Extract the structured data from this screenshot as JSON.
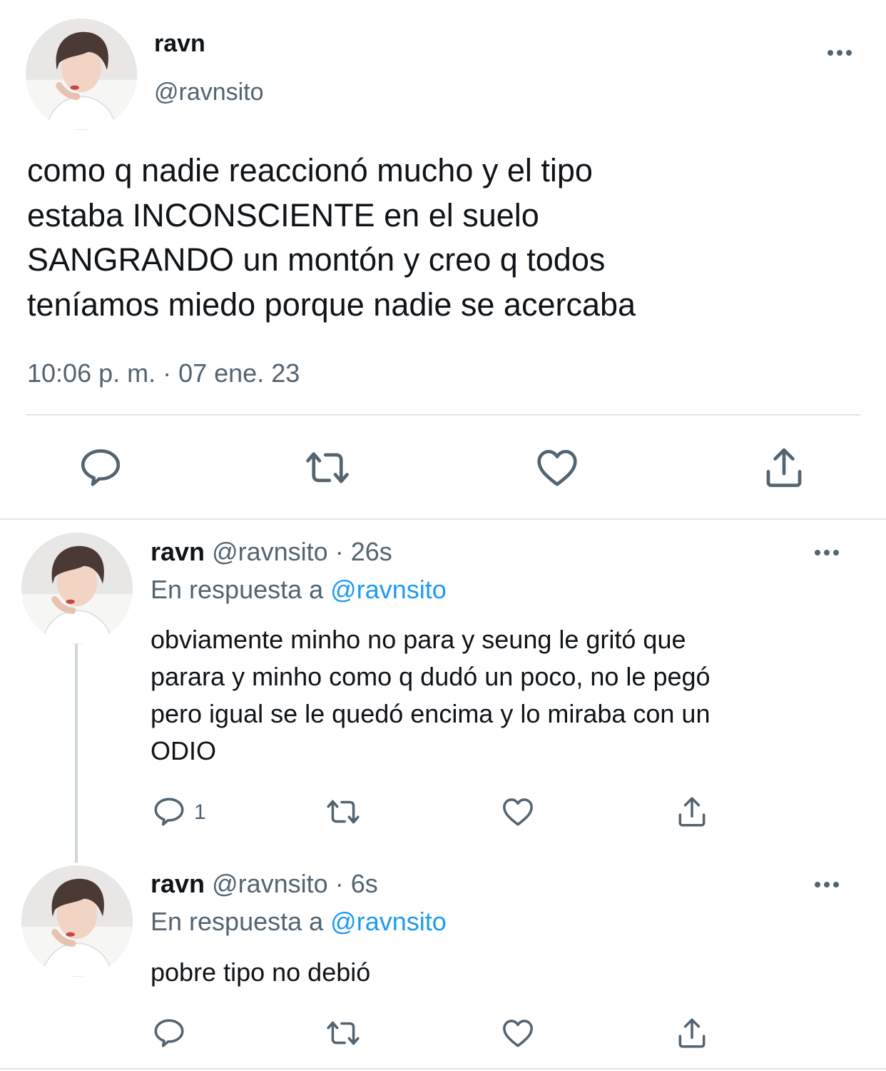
{
  "main_tweet": {
    "display_name": "ravn",
    "handle": "@ravnsito",
    "lines": [
      "como q nadie reaccionó mucho y el tipo",
      "estaba INCONSCIENTE en el suelo",
      "SANGRANDO un montón y creo q todos",
      "teníamos miedo porque nadie se acercaba"
    ],
    "timestamp": "10:06 p. m. · 07 ene. 23",
    "actions": [
      "reply-icon",
      "retweet-icon",
      "like-icon",
      "share-icon"
    ]
  },
  "replies": [
    {
      "display_name": "ravn",
      "handle": "@ravnsito",
      "sep": "·",
      "age": "26s",
      "reply_prefix": "En respuesta a",
      "reply_to": "@ravnsito",
      "lines": [
        "obviamente minho no para y seung le gritó que",
        "parara y minho como q dudó un poco, no le pegó",
        "pero igual se le quedó encima y lo miraba con un",
        "ODIO"
      ],
      "reply_count": "1"
    },
    {
      "display_name": "ravn",
      "handle": "@ravnsito",
      "sep": "·",
      "age": "6s",
      "reply_prefix": "En respuesta a",
      "reply_to": "@ravnsito",
      "lines": [
        "pobre tipo no debió"
      ],
      "reply_count": ""
    }
  ],
  "colors": {
    "text": "#0f1419",
    "muted": "#536471",
    "link": "#1d9bf0",
    "divider": "#e1e5e8"
  }
}
